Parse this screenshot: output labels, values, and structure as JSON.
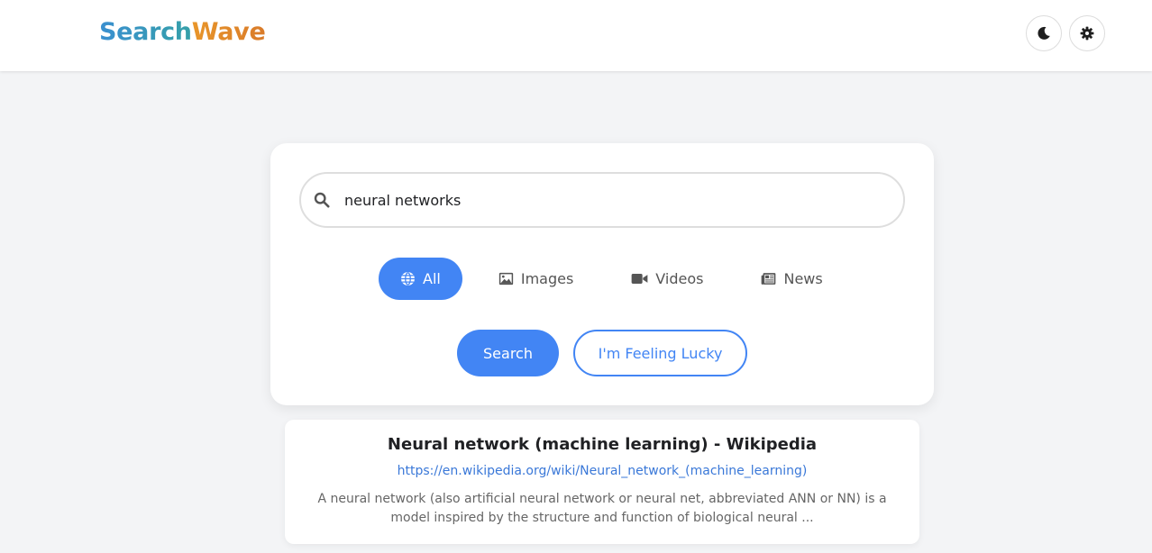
{
  "header": {
    "logo_part1": "Search",
    "logo_part2": "Wave",
    "theme_toggle_icon": "moon-icon",
    "settings_icon": "gear-icon"
  },
  "search": {
    "query": "neural networks",
    "icon": "search-icon"
  },
  "tabs": [
    {
      "label": "All",
      "icon": "globe-icon",
      "active": true
    },
    {
      "label": "Images",
      "icon": "image-icon",
      "active": false
    },
    {
      "label": "Videos",
      "icon": "video-icon",
      "active": false
    },
    {
      "label": "News",
      "icon": "newspaper-icon",
      "active": false
    }
  ],
  "buttons": {
    "search_label": "Search",
    "lucky_label": "I'm Feeling Lucky"
  },
  "results": [
    {
      "title": "Neural network (machine learning) - Wikipedia",
      "url": "https://en.wikipedia.org/wiki/Neural_network_(machine_learning)",
      "snippet": "A neural network (also artificial neural network or neural net, abbreviated ANN or NN) is a model inspired by the structure and function of biological neural ..."
    }
  ],
  "colors": {
    "accent": "#4285f4",
    "logo_search": "#3a8fd0",
    "logo_wave": "#e8962a",
    "page_bg": "#f3f4f6"
  }
}
